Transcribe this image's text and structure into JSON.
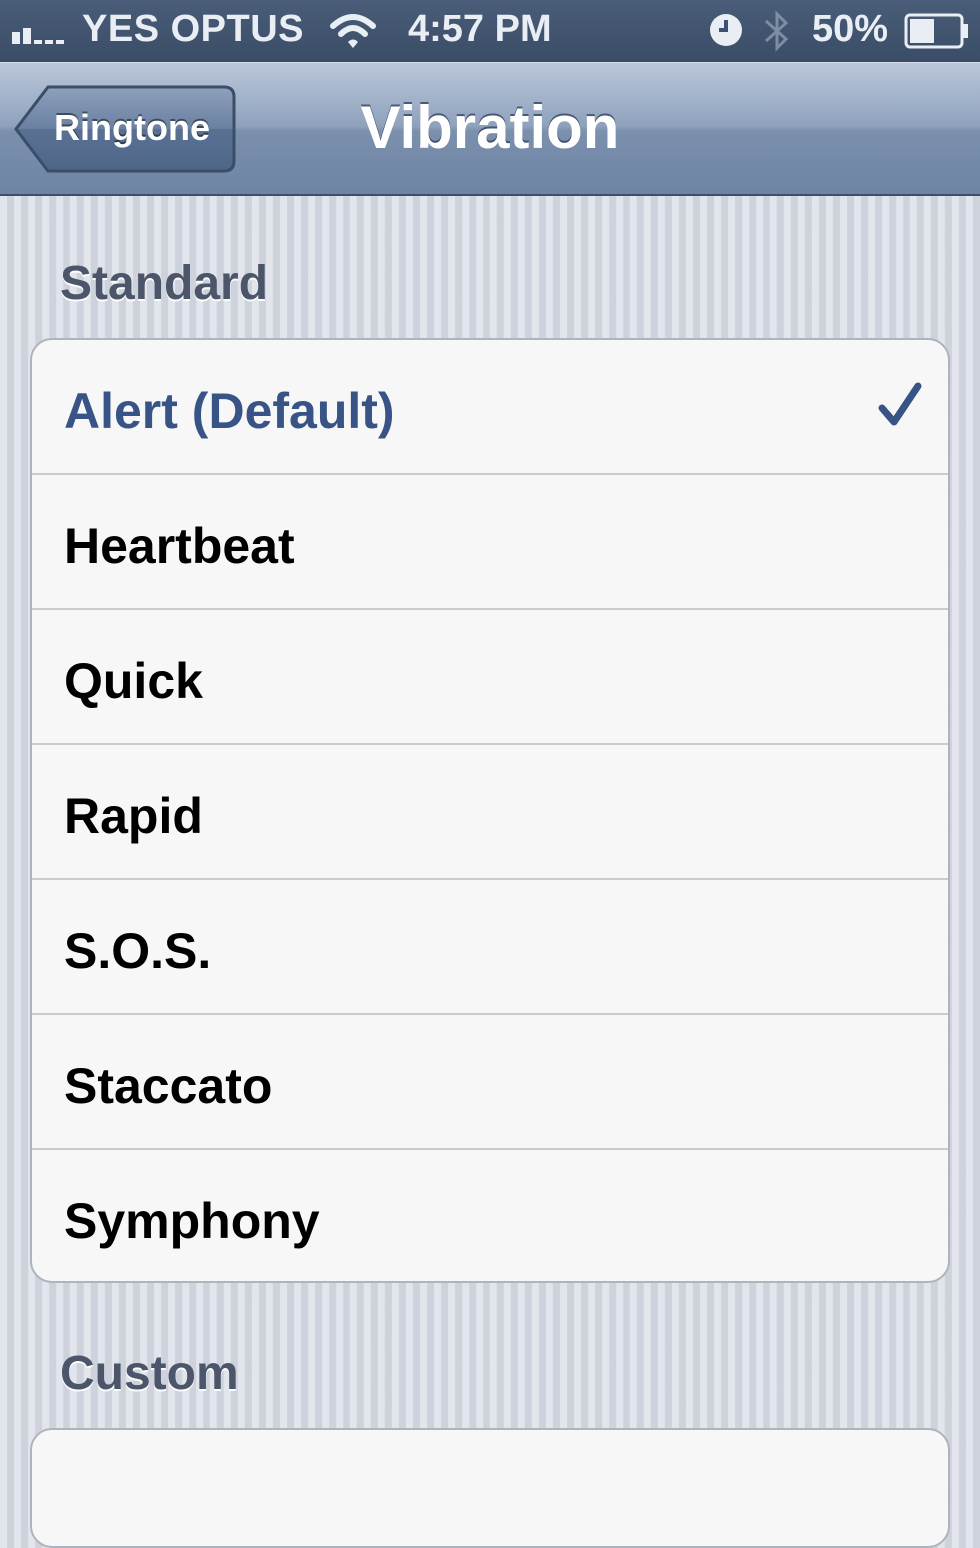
{
  "status_bar": {
    "carrier": "YES OPTUS",
    "time": "4:57 PM",
    "battery_percent": "50%",
    "battery_level": 0.5,
    "icons": [
      "signal-icon",
      "wifi-icon",
      "alarm-icon",
      "bluetooth-icon",
      "battery-icon"
    ]
  },
  "nav": {
    "back_label": "Ringtone",
    "title": "Vibration"
  },
  "sections": {
    "standard": {
      "header": "Standard",
      "items": [
        {
          "label": "Alert (Default)",
          "selected": true
        },
        {
          "label": "Heartbeat",
          "selected": false
        },
        {
          "label": "Quick",
          "selected": false
        },
        {
          "label": "Rapid",
          "selected": false
        },
        {
          "label": "S.O.S.",
          "selected": false
        },
        {
          "label": "Staccato",
          "selected": false
        },
        {
          "label": "Symphony",
          "selected": false
        }
      ]
    },
    "custom": {
      "header": "Custom"
    }
  },
  "colors": {
    "selected_text": "#385487",
    "status_bar": "#3f5170",
    "nav_bar": "#8fa2bd"
  }
}
